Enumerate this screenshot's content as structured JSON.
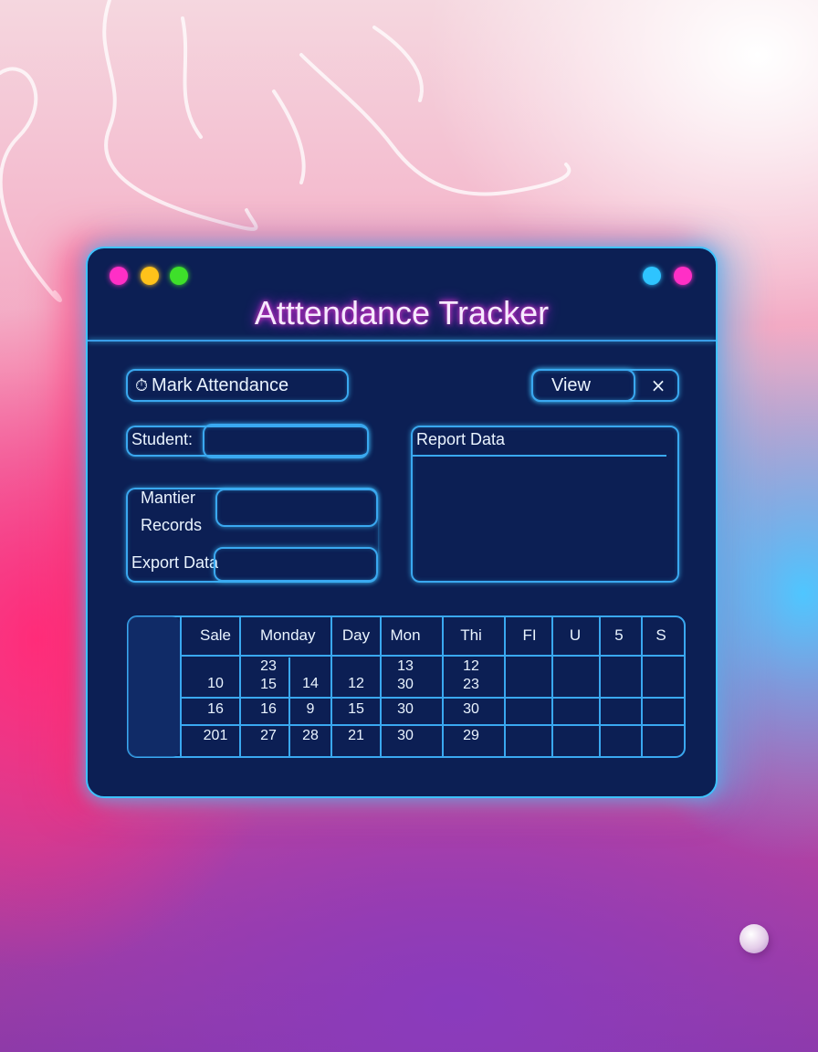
{
  "window": {
    "title": "Atttendance Tracker",
    "traffic_lights": [
      "#ff2fc6",
      "#ffc21a",
      "#3ee02a"
    ],
    "right_dots": [
      "#2ec4ff",
      "#ff2fc6"
    ]
  },
  "actions": {
    "mark_attendance": {
      "icon": "clock-icon",
      "icon_glyph": "⏱",
      "label": "Mark Attendance"
    },
    "view": {
      "label": "View"
    },
    "close_glyph": "×"
  },
  "form": {
    "student_label": "Student:",
    "student_value": "",
    "mantier_label_line1": "Mantier",
    "mantier_label_line2": "Records",
    "mantier_value": "",
    "export_label": "Export Data",
    "export_value": ""
  },
  "report": {
    "title": "Report Data"
  },
  "table": {
    "headers": [
      "Sale",
      "Monday",
      "Day",
      "Mon",
      "Thi",
      "FI",
      "U",
      "5",
      "S"
    ],
    "rows": [
      [
        "10",
        "23\n15",
        "14",
        "12",
        "13\n30",
        "12\n23",
        "",
        "",
        ""
      ],
      [
        "16",
        "16",
        "9",
        "15",
        "30",
        "30",
        "",
        "",
        ""
      ],
      [
        "201",
        "27",
        "28",
        "21",
        "30",
        "29",
        "",
        "",
        ""
      ]
    ]
  },
  "colors": {
    "window_bg": "#0c1f54",
    "neon_blue": "#3ec2ff",
    "neon_pink": "#ff3fd4"
  }
}
